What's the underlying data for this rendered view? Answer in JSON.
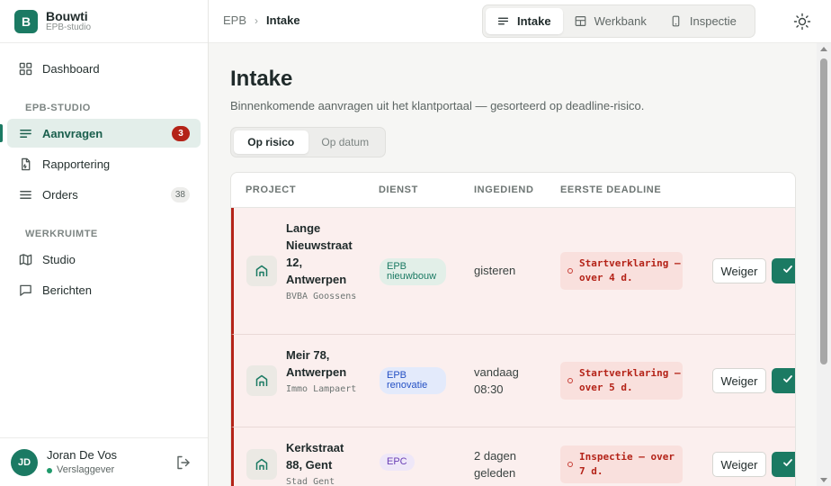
{
  "brand": {
    "logo_letter": "B",
    "name": "Bouwti",
    "subtitle": "EPB-studio"
  },
  "sidebar": {
    "top_items": [
      {
        "label": "Dashboard",
        "icon": "dashboard-icon"
      }
    ],
    "sections": [
      {
        "title": "EPB-STUDIO",
        "items": [
          {
            "label": "Aanvragen",
            "icon": "list-icon",
            "badge": "3",
            "active": true
          },
          {
            "label": "Rapportering",
            "icon": "document-icon"
          },
          {
            "label": "Orders",
            "icon": "menu-icon",
            "badge": "38"
          }
        ]
      },
      {
        "title": "WERKRUIMTE",
        "items": [
          {
            "label": "Studio",
            "icon": "map-icon"
          },
          {
            "label": "Berichten",
            "icon": "message-icon"
          }
        ]
      }
    ]
  },
  "user": {
    "initials": "JD",
    "name": "Joran De Vos",
    "role": "Verslaggever"
  },
  "breadcrumb": {
    "parent": "EPB",
    "current": "Intake"
  },
  "view_tabs": [
    {
      "label": "Intake",
      "icon": "list-icon",
      "active": true
    },
    {
      "label": "Werkbank",
      "icon": "layout-icon"
    },
    {
      "label": "Inspectie",
      "icon": "phone-icon"
    }
  ],
  "page": {
    "title": "Intake",
    "description": "Binnenkomende aanvragen uit het klantportaal — gesorteerd op deadline-risico."
  },
  "sort_toggle": {
    "option_1": "Op risico",
    "option_2": "Op datum",
    "active": "Op risico"
  },
  "table": {
    "headers": {
      "project": "PROJECT",
      "dienst": "DIENST",
      "ingediend": "INGEDIEND",
      "deadline": "EERSTE DEADLINE"
    },
    "rows": [
      {
        "project": "Lange Nieuwstraat 12, Antwerpen",
        "client": "BVBA Goossens",
        "service": "EPB nieuwbouw",
        "service_color": "green",
        "submitted": "gisteren",
        "deadline": "Startverklaring — over 4 d.",
        "reject_label": "Weiger"
      },
      {
        "project": "Meir 78, Antwerpen",
        "client": "Immo Lampaert",
        "service": "EPB renovatie",
        "service_color": "blue",
        "submitted": "vandaag 08:30",
        "deadline": "Startverklaring — over 5 d.",
        "reject_label": "Weiger"
      },
      {
        "project": "Kerkstraat 88, Gent",
        "client": "Stad Gent",
        "service": "EPC",
        "service_color": "purple",
        "submitted": "2 dagen geleden",
        "deadline": "Inspectie — over 7 d.",
        "reject_label": "Weiger"
      }
    ]
  },
  "colors": {
    "accent": "#1b7a63",
    "danger": "#b42318",
    "row_risk_bg": "#fbefee"
  }
}
